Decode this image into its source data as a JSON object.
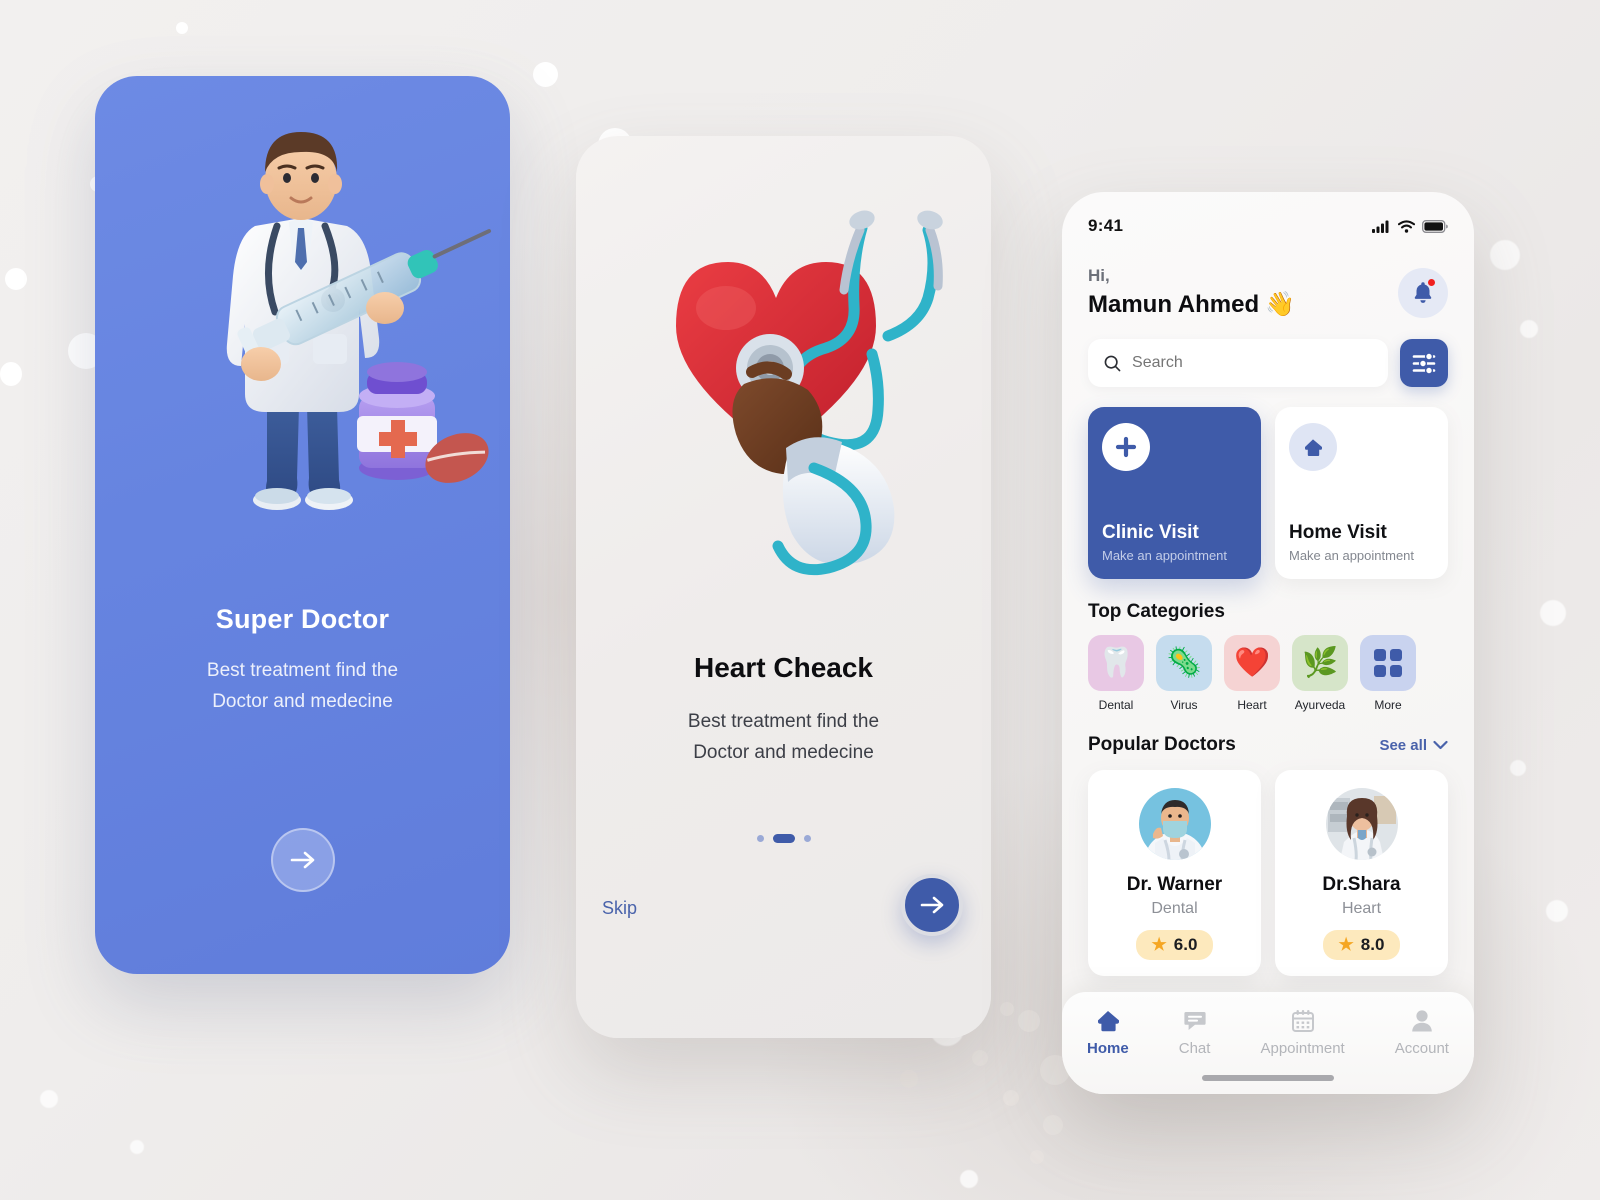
{
  "background": {
    "canvas_color": "#f0eeee",
    "bokeh_color": "#ffffff"
  },
  "onboarding_1": {
    "name": "super-doctor-slide",
    "bg_color": "#6684e0",
    "title": "Super Doctor",
    "subtitle_line1": "Best treatment find the",
    "subtitle_line2": "Doctor and medecine",
    "next_label": "→",
    "illustration": "doctor-with-syringe-3d"
  },
  "onboarding_2": {
    "name": "heart-check-slide",
    "bg_color": "#efeceb",
    "title": "Heart Cheack",
    "subtitle_line1": "Best treatment find the",
    "subtitle_line2": "Doctor and medecine",
    "skip_label": "Skip",
    "next_label": "→",
    "illustration": "heart-stethoscope-3d",
    "pagination": {
      "total": 3,
      "active_index": 1,
      "active_color": "#3f5ba9",
      "inactive_color": "#9aa9d6"
    }
  },
  "app": {
    "accent_color": "#3f5ba9",
    "status_bar": {
      "time": "9:41",
      "icons": [
        "cellular-signal-icon",
        "wifi-icon",
        "battery-icon"
      ]
    },
    "header": {
      "greeting": "Hi,",
      "user_name": "Mamun Ahmed",
      "wave_emoji": "👋",
      "notification_icon": "bell-icon",
      "has_unread": true,
      "unread_color": "#f02020"
    },
    "search": {
      "placeholder": "Search",
      "icon": "search-icon",
      "filter_icon": "sliders-icon"
    },
    "visit_cards": [
      {
        "title": "Clinic Visit",
        "subtitle": "Make an appointment",
        "icon": "plus-icon",
        "style": "primary"
      },
      {
        "title": "Home Visit",
        "subtitle": "Make an appointment",
        "icon": "home-icon",
        "style": "plain"
      }
    ],
    "categories": {
      "title": "Top Categories",
      "items": [
        {
          "label": "Dental",
          "icon": "tooth-icon",
          "emoji": "🦷",
          "tile_color": "#e8c8e4"
        },
        {
          "label": "Virus",
          "icon": "virus-icon",
          "emoji": "🦠",
          "tile_color": "#c5dcee"
        },
        {
          "label": "Heart",
          "icon": "heart-icon",
          "emoji": "❤️",
          "tile_color": "#f5d3d3"
        },
        {
          "label": "Ayurveda",
          "icon": "mortar-icon",
          "emoji": "🌿",
          "tile_color": "#d6e5c9"
        },
        {
          "label": "More",
          "icon": "grid-more-icon",
          "emoji": "",
          "tile_color": "#c9d3ef"
        }
      ]
    },
    "popular_doctors": {
      "title": "Popular Doctors",
      "see_all_label": "See all",
      "see_all_icon": "chevron-down-icon",
      "items": [
        {
          "name": "Dr. Warner",
          "specialty": "Dental",
          "rating": "6.0",
          "avatar": "male-doctor-photo"
        },
        {
          "name": "Dr.Shara",
          "specialty": "Heart",
          "rating": "8.0",
          "avatar": "female-doctor-photo"
        }
      ],
      "rating_badge_color": "#fde9bd",
      "star_color": "#f5a623"
    },
    "tabbar": {
      "items": [
        {
          "label": "Home",
          "icon": "home-icon",
          "active": true
        },
        {
          "label": "Chat",
          "icon": "chat-icon",
          "active": false
        },
        {
          "label": "Appointment",
          "icon": "calendar-icon",
          "active": false
        },
        {
          "label": "Account",
          "icon": "person-icon",
          "active": false
        }
      ]
    }
  }
}
